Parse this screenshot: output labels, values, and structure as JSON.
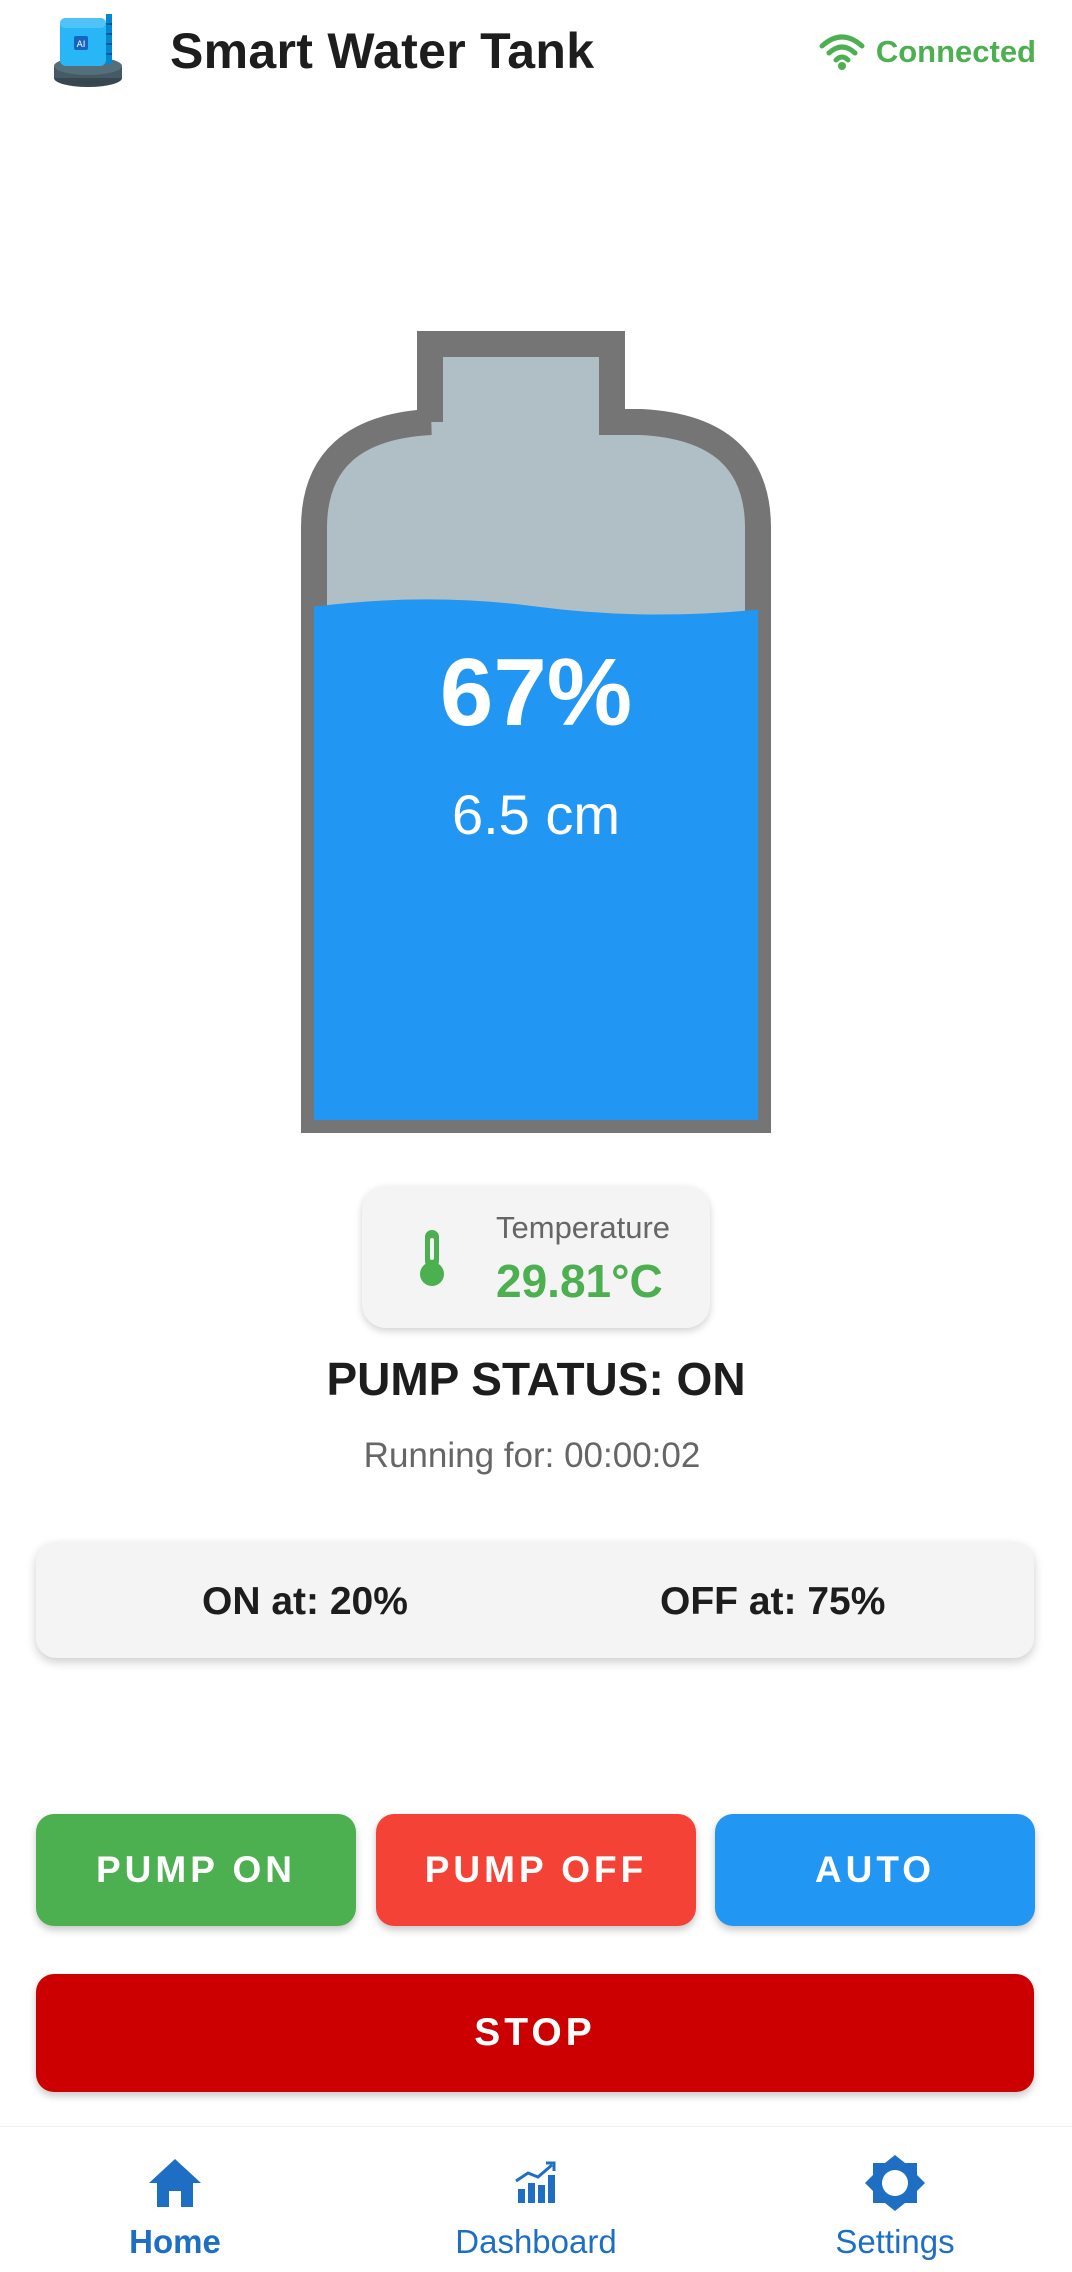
{
  "header": {
    "title": "Smart Water Tank",
    "logo_icon": "water-tank-icon",
    "connection": {
      "status": "Connected",
      "icon": "wifi-icon",
      "color": "#4caf50"
    }
  },
  "tank": {
    "level_percent": "67%",
    "level_fraction": 0.67,
    "depth": "6.5 cm",
    "water_color": "#2196f3",
    "empty_color": "#b0bec5",
    "outline_color": "#757575"
  },
  "temperature": {
    "label": "Temperature",
    "value": "29.81°C",
    "icon": "thermometer-icon",
    "color": "#4caf50"
  },
  "pump": {
    "status": "PUMP STATUS: ON",
    "running_for": "Running for: 00:00:02"
  },
  "thresholds": {
    "on_label": "ON at: 20%",
    "off_label": "OFF at: 75%"
  },
  "controls": {
    "pump_on": {
      "label": "PUMP ON",
      "color": "#4caf50"
    },
    "pump_off": {
      "label": "PUMP OFF",
      "color": "#f44336"
    },
    "auto": {
      "label": "AUTO",
      "color": "#2196f3"
    },
    "stop": {
      "label": "STOP",
      "color": "#cc0000"
    }
  },
  "bottom_nav": {
    "accent": "#1e6fc4",
    "items": [
      {
        "label": "Home",
        "icon": "home-icon",
        "active": true
      },
      {
        "label": "Dashboard",
        "icon": "dashboard-icon",
        "active": false
      },
      {
        "label": "Settings",
        "icon": "settings-icon",
        "active": false
      }
    ]
  }
}
